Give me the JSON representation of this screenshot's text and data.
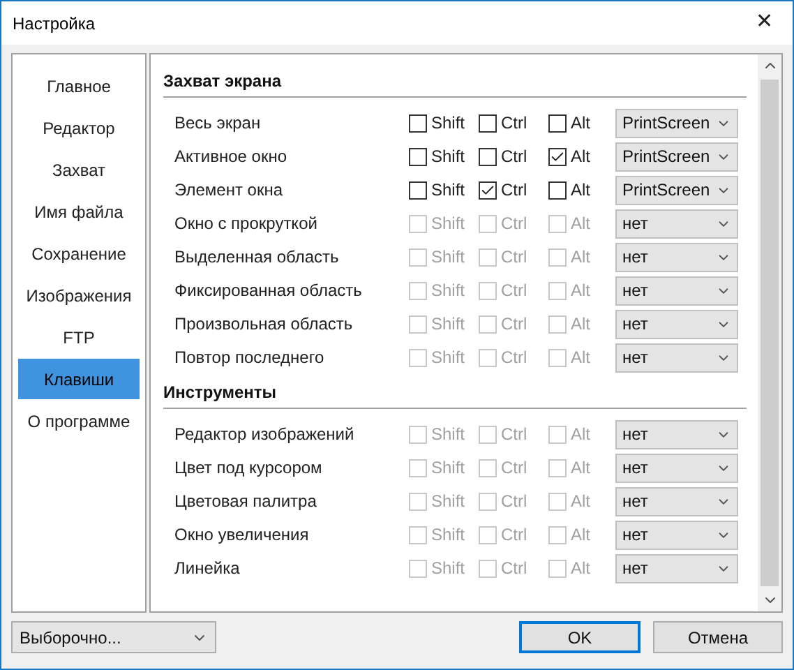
{
  "window": {
    "title": "Настройка",
    "close": "✕"
  },
  "sidebar": {
    "items": [
      {
        "label": "Главное",
        "selected": false
      },
      {
        "label": "Редактор",
        "selected": false
      },
      {
        "label": "Захват",
        "selected": false
      },
      {
        "label": "Имя файла",
        "selected": false
      },
      {
        "label": "Сохранение",
        "selected": false
      },
      {
        "label": "Изображения",
        "selected": false
      },
      {
        "label": "FTP",
        "selected": false
      },
      {
        "label": "Клавиши",
        "selected": true
      },
      {
        "label": "О программе",
        "selected": false
      }
    ]
  },
  "sections": [
    {
      "title": "Захват экрана",
      "rows": [
        {
          "label": "Весь экран",
          "disabled": false,
          "keys": [
            {
              "label": "Shift",
              "checked": false
            },
            {
              "label": "Ctrl",
              "checked": false
            },
            {
              "label": "Alt",
              "checked": false
            }
          ],
          "value": "PrintScreen"
        },
        {
          "label": "Активное окно",
          "disabled": false,
          "keys": [
            {
              "label": "Shift",
              "checked": false
            },
            {
              "label": "Ctrl",
              "checked": false
            },
            {
              "label": "Alt",
              "checked": true
            }
          ],
          "value": "PrintScreen"
        },
        {
          "label": "Элемент окна",
          "disabled": false,
          "keys": [
            {
              "label": "Shift",
              "checked": false
            },
            {
              "label": "Ctrl",
              "checked": true
            },
            {
              "label": "Alt",
              "checked": false
            }
          ],
          "value": "PrintScreen"
        },
        {
          "label": "Окно с прокруткой",
          "disabled": true,
          "keys": [
            {
              "label": "Shift",
              "checked": false
            },
            {
              "label": "Ctrl",
              "checked": false
            },
            {
              "label": "Alt",
              "checked": false
            }
          ],
          "value": "нет"
        },
        {
          "label": "Выделенная область",
          "disabled": true,
          "keys": [
            {
              "label": "Shift",
              "checked": false
            },
            {
              "label": "Ctrl",
              "checked": false
            },
            {
              "label": "Alt",
              "checked": false
            }
          ],
          "value": "нет"
        },
        {
          "label": "Фиксированная область",
          "disabled": true,
          "keys": [
            {
              "label": "Shift",
              "checked": false
            },
            {
              "label": "Ctrl",
              "checked": false
            },
            {
              "label": "Alt",
              "checked": false
            }
          ],
          "value": "нет"
        },
        {
          "label": "Произвольная область",
          "disabled": true,
          "keys": [
            {
              "label": "Shift",
              "checked": false
            },
            {
              "label": "Ctrl",
              "checked": false
            },
            {
              "label": "Alt",
              "checked": false
            }
          ],
          "value": "нет"
        },
        {
          "label": "Повтор последнего",
          "disabled": true,
          "keys": [
            {
              "label": "Shift",
              "checked": false
            },
            {
              "label": "Ctrl",
              "checked": false
            },
            {
              "label": "Alt",
              "checked": false
            }
          ],
          "value": "нет"
        }
      ]
    },
    {
      "title": "Инструменты",
      "rows": [
        {
          "label": "Редактор изображений",
          "disabled": true,
          "keys": [
            {
              "label": "Shift",
              "checked": false
            },
            {
              "label": "Ctrl",
              "checked": false
            },
            {
              "label": "Alt",
              "checked": false
            }
          ],
          "value": "нет"
        },
        {
          "label": "Цвет под курсором",
          "disabled": true,
          "keys": [
            {
              "label": "Shift",
              "checked": false
            },
            {
              "label": "Ctrl",
              "checked": false
            },
            {
              "label": "Alt",
              "checked": false
            }
          ],
          "value": "нет"
        },
        {
          "label": "Цветовая палитра",
          "disabled": true,
          "keys": [
            {
              "label": "Shift",
              "checked": false
            },
            {
              "label": "Ctrl",
              "checked": false
            },
            {
              "label": "Alt",
              "checked": false
            }
          ],
          "value": "нет"
        },
        {
          "label": "Окно увеличения",
          "disabled": true,
          "keys": [
            {
              "label": "Shift",
              "checked": false
            },
            {
              "label": "Ctrl",
              "checked": false
            },
            {
              "label": "Alt",
              "checked": false
            }
          ],
          "value": "нет"
        },
        {
          "label": "Линейка",
          "disabled": true,
          "keys": [
            {
              "label": "Shift",
              "checked": false
            },
            {
              "label": "Ctrl",
              "checked": false
            },
            {
              "label": "Alt",
              "checked": false
            }
          ],
          "value": "нет"
        }
      ]
    }
  ],
  "footer": {
    "preset": "Выборочно...",
    "buttons": [
      {
        "label": "OK",
        "default": true
      },
      {
        "label": "Отмена",
        "default": false
      }
    ]
  }
}
